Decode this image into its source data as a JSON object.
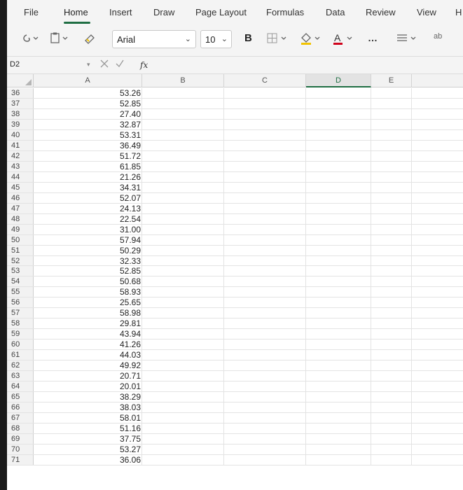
{
  "ribbon": {
    "tabs": [
      "File",
      "Home",
      "Insert",
      "Draw",
      "Page Layout",
      "Formulas",
      "Data",
      "Review",
      "View",
      "H"
    ],
    "active_tab": "Home"
  },
  "toolbar": {
    "font_name": "Arial",
    "font_size": "10",
    "bold_label": "B",
    "more_label": "…",
    "wrap_label": "ab"
  },
  "formula_bar": {
    "name_box": "D2",
    "cancel_icon": "x-icon",
    "confirm_icon": "check-icon",
    "fx_label": "fx",
    "value": ""
  },
  "grid": {
    "columns": [
      "A",
      "B",
      "C",
      "D",
      "E"
    ],
    "selected_column": "D",
    "rows": [
      {
        "n": "36",
        "a": "53.26"
      },
      {
        "n": "37",
        "a": "52.85"
      },
      {
        "n": "38",
        "a": "27.40"
      },
      {
        "n": "39",
        "a": "32.87"
      },
      {
        "n": "40",
        "a": "53.31"
      },
      {
        "n": "41",
        "a": "36.49"
      },
      {
        "n": "42",
        "a": "51.72"
      },
      {
        "n": "43",
        "a": "61.85"
      },
      {
        "n": "44",
        "a": "21.26"
      },
      {
        "n": "45",
        "a": "34.31"
      },
      {
        "n": "46",
        "a": "52.07"
      },
      {
        "n": "47",
        "a": "24.13"
      },
      {
        "n": "48",
        "a": "22.54"
      },
      {
        "n": "49",
        "a": "31.00"
      },
      {
        "n": "50",
        "a": "57.94"
      },
      {
        "n": "51",
        "a": "50.29"
      },
      {
        "n": "52",
        "a": "32.33"
      },
      {
        "n": "53",
        "a": "52.85"
      },
      {
        "n": "54",
        "a": "50.68"
      },
      {
        "n": "55",
        "a": "58.93"
      },
      {
        "n": "56",
        "a": "25.65"
      },
      {
        "n": "57",
        "a": "58.98"
      },
      {
        "n": "58",
        "a": "29.81"
      },
      {
        "n": "59",
        "a": "43.94"
      },
      {
        "n": "60",
        "a": "41.26"
      },
      {
        "n": "61",
        "a": "44.03"
      },
      {
        "n": "62",
        "a": "49.92"
      },
      {
        "n": "63",
        "a": "20.71"
      },
      {
        "n": "64",
        "a": "20.01"
      },
      {
        "n": "65",
        "a": "38.29"
      },
      {
        "n": "66",
        "a": "38.03"
      },
      {
        "n": "67",
        "a": "58.01"
      },
      {
        "n": "68",
        "a": "51.16"
      },
      {
        "n": "69",
        "a": "37.75"
      },
      {
        "n": "70",
        "a": "53.27"
      },
      {
        "n": "71",
        "a": "36.06"
      }
    ]
  },
  "colors": {
    "accent": "#1f6e43",
    "highlight_yellow": "#f2c300",
    "font_red": "#d0021b"
  }
}
